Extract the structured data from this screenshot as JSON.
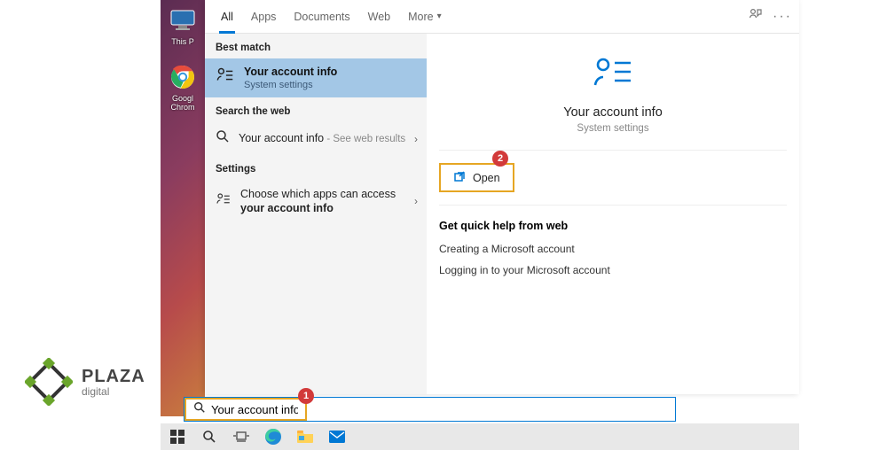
{
  "desktop": {
    "icons": [
      {
        "label": "This P"
      },
      {
        "label": "Googl\nChrom"
      }
    ]
  },
  "tabs": {
    "items": [
      "All",
      "Apps",
      "Documents",
      "Web",
      "More"
    ]
  },
  "left": {
    "best_label": "Best match",
    "best_title": "Your account info",
    "best_sub": "System settings",
    "web_label": "Search the web",
    "web_text": "Your account info",
    "web_suffix": " - See web results",
    "settings_label": "Settings",
    "settings_text_a": "Choose which apps can access ",
    "settings_text_b": "your account info"
  },
  "right": {
    "title": "Your account info",
    "sub": "System settings",
    "open": "Open",
    "help_title": "Get quick help from web",
    "help_links": [
      "Creating a Microsoft account",
      "Logging in to your Microsoft account"
    ]
  },
  "search": {
    "value": "Your account info"
  },
  "badges": {
    "one": "1",
    "two": "2"
  },
  "brand": {
    "name": "PLAZA",
    "sub": "digital"
  },
  "colors": {
    "accent": "#0078d4",
    "highlight": "#e6a623",
    "badge": "#d23a3a",
    "bestbg": "#a3c7e6"
  }
}
